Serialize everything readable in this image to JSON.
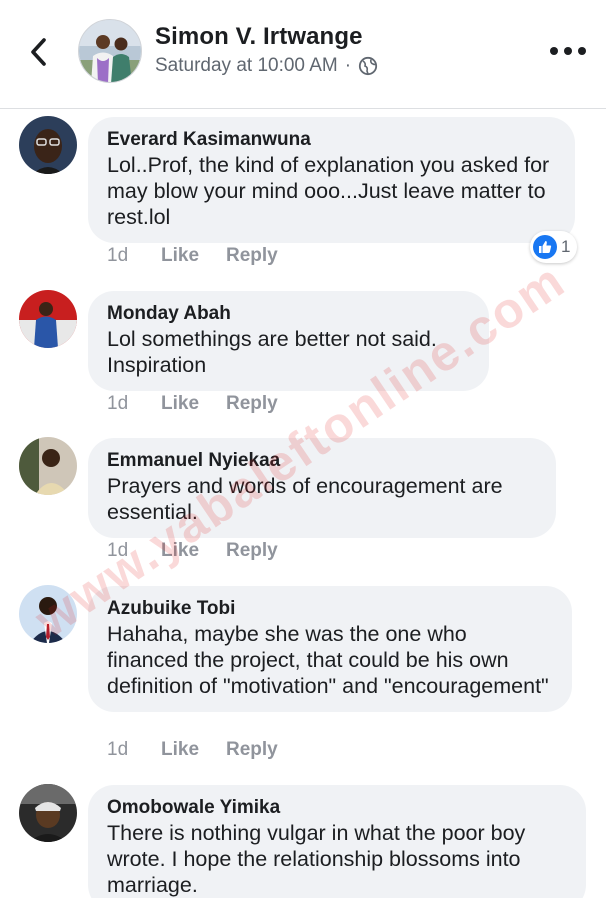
{
  "header": {
    "author": "Simon V. Irtwange",
    "timestamp": "Saturday at 10:00 AM",
    "separator": "·",
    "privacy_icon": "globe-icon",
    "back_icon": "chevron-left-icon",
    "more_icon": "more-dots-icon"
  },
  "comments": [
    {
      "author": "Everard Kasimanwuna",
      "text": "Lol..Prof, the kind of explanation you asked for may blow your mind ooo...Just leave matter to rest.lol",
      "time": "1d",
      "like": "Like",
      "reply": "Reply",
      "reaction_count": "1",
      "reaction_icon": "like-thumb-icon"
    },
    {
      "author": "Monday Abah",
      "text": "Lol somethings are better not said. Inspiration",
      "time": "1d",
      "like": "Like",
      "reply": "Reply"
    },
    {
      "author": "Emmanuel Nyiekaa",
      "text": "Prayers and words of encouragement are essential.",
      "time": "1d",
      "like": "Like",
      "reply": "Reply"
    },
    {
      "author": "Azubuike Tobi",
      "text": "Hahaha, maybe she was the one who financed the project, that could be his own definition of \"motivation\" and \"encouragement\"",
      "time": "1d",
      "like": "Like",
      "reply": "Reply"
    },
    {
      "author": "Omobowale Yimika",
      "text": "There is nothing vulgar in what the poor boy wrote. I hope the relationship blossoms into marriage.",
      "time": "",
      "like": "",
      "reply": ""
    }
  ],
  "watermark": "www.yabaleftonline.com",
  "colors": {
    "bubble": "#f0f2f5",
    "action_grey": "#90949c",
    "like_blue": "#1877f2",
    "watermark_red": "#e41c1c"
  }
}
